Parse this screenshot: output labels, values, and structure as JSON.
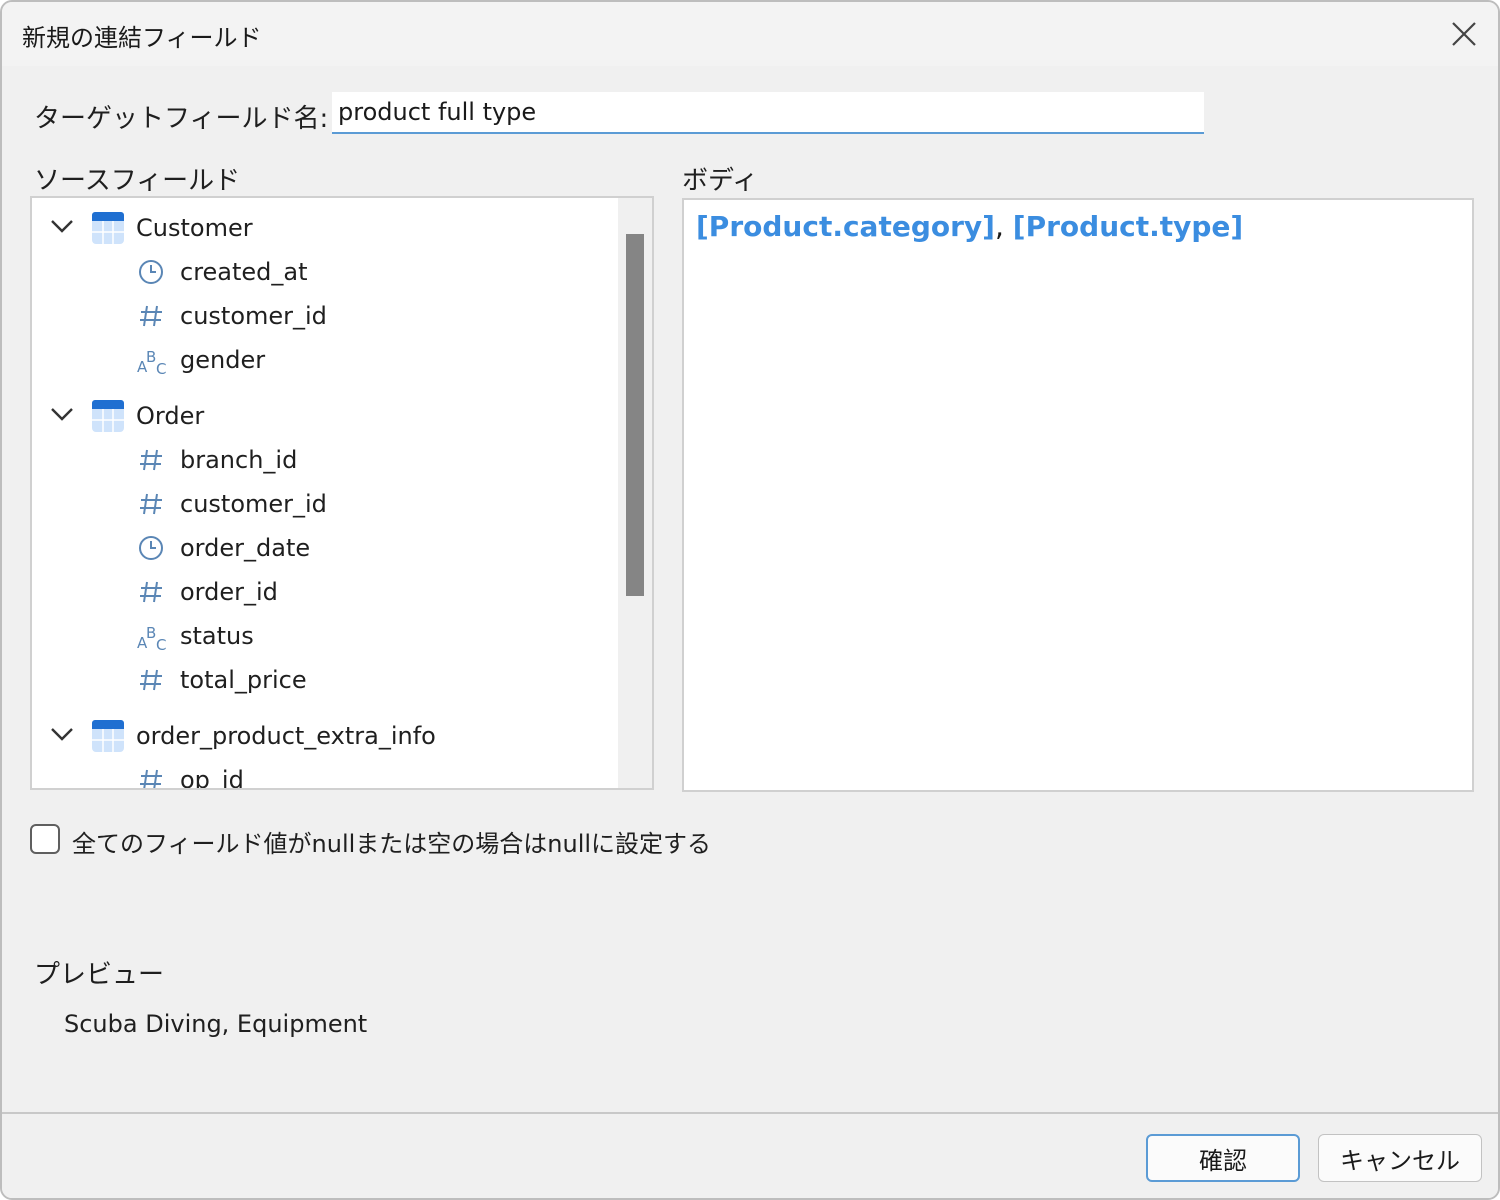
{
  "dialog": {
    "title": "新規の連結フィールド",
    "target_label": "ターゲットフィールド名:",
    "target_value": "product full type",
    "source_label": "ソースフィールド",
    "body_label": "ボディ"
  },
  "tree": {
    "groups": [
      {
        "name": "Customer",
        "fields": [
          {
            "name": "created_at",
            "icon": "clock-icon"
          },
          {
            "name": "customer_id",
            "icon": "hash-icon"
          },
          {
            "name": "gender",
            "icon": "abc-icon"
          }
        ]
      },
      {
        "name": "Order",
        "fields": [
          {
            "name": "branch_id",
            "icon": "hash-icon"
          },
          {
            "name": "customer_id",
            "icon": "hash-icon"
          },
          {
            "name": "order_date",
            "icon": "clock-icon"
          },
          {
            "name": "order_id",
            "icon": "hash-icon"
          },
          {
            "name": "status",
            "icon": "abc-icon"
          },
          {
            "name": "total_price",
            "icon": "hash-icon"
          }
        ]
      },
      {
        "name": "order_product_extra_info",
        "fields": [
          {
            "name": "op_id",
            "icon": "hash-icon"
          }
        ]
      }
    ]
  },
  "body": {
    "token1": "[Product.category]",
    "separator": ", ",
    "token2": "[Product.type]"
  },
  "null_option": {
    "label": "全てのフィールド値がnullまたは空の場合はnullに設定する",
    "checked": false
  },
  "preview": {
    "label": "プレビュー",
    "value": "Scuba Diving, Equipment"
  },
  "buttons": {
    "ok": "確認",
    "cancel": "キャンセル"
  },
  "colors": {
    "accent": "#5b9bd5",
    "token": "#3b8de0",
    "icon": "#5a86b5"
  }
}
